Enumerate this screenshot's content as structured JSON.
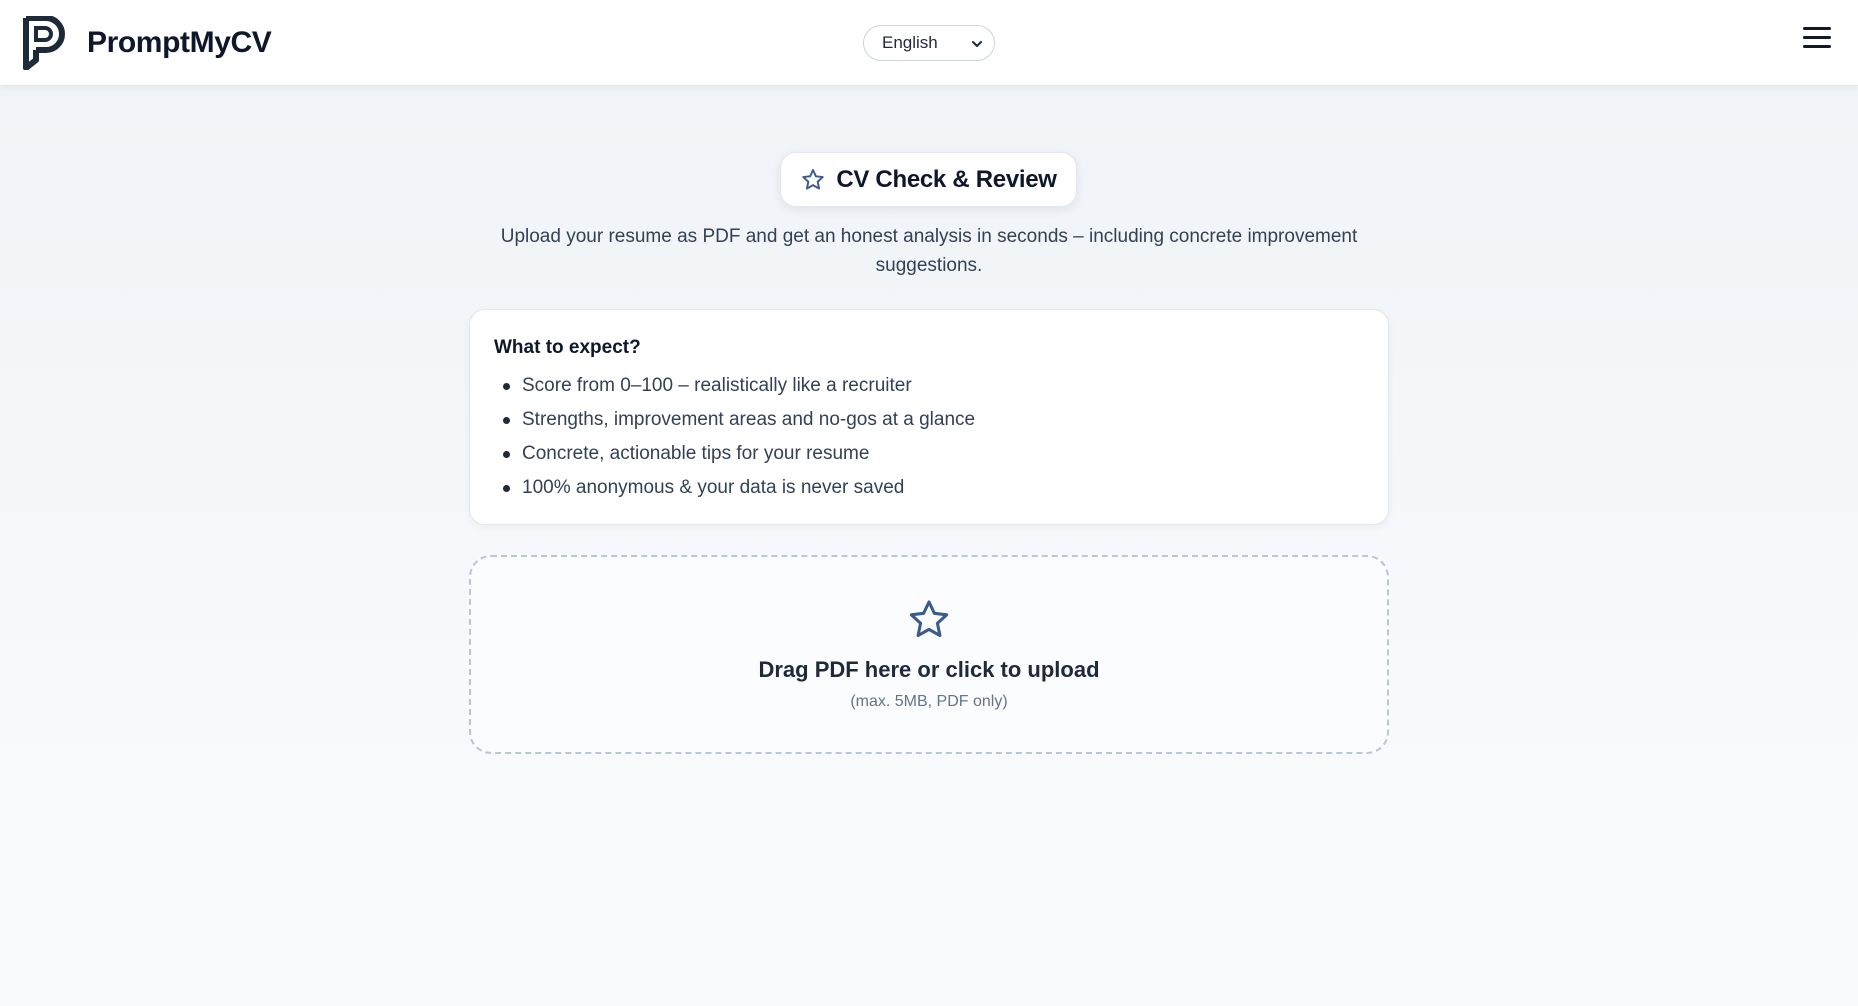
{
  "header": {
    "brand_name": "PromptMyCV",
    "language_selected": "English",
    "menu_icon": "hamburger-menu-icon",
    "logo_icon": "promptmycv-logo-icon"
  },
  "main": {
    "title": "CV Check & Review",
    "title_icon": "star-outline-icon",
    "subtitle": "Upload your resume as PDF and get an honest analysis in seconds – including concrete improvement suggestions.",
    "expect": {
      "heading": "What to expect?",
      "items": [
        "Score from 0–100 – realistically like a recruiter",
        "Strengths, improvement areas and no-gos at a glance",
        "Concrete, actionable tips for your resume",
        "100% anonymous & your data is never saved"
      ]
    },
    "upload": {
      "icon": "star-outline-icon",
      "label": "Drag PDF here or click to upload",
      "hint": "(max. 5MB, PDF only)"
    }
  },
  "colors": {
    "accent": "#3b5b8f",
    "text_dark": "#0f172a",
    "text_body": "#334155",
    "background": "#f1f5f9"
  }
}
